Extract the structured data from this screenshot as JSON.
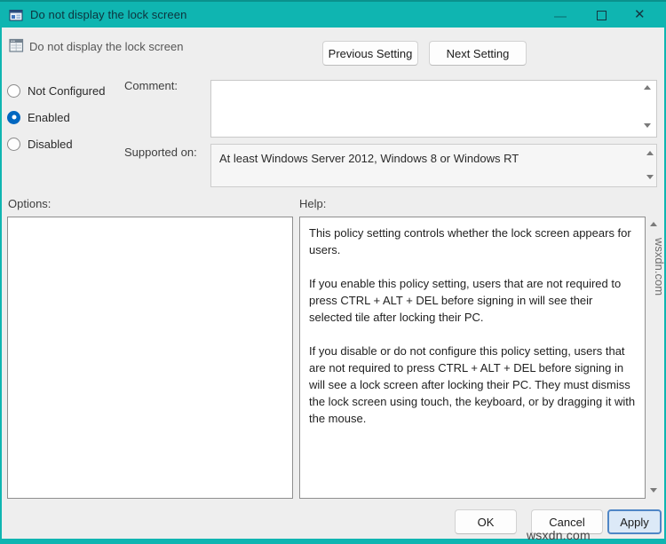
{
  "window": {
    "title": "Do not display the lock screen",
    "close_glyph": "✕"
  },
  "header": {
    "policy_title": "Do not display the lock screen",
    "previous_setting_label": "Previous Setting",
    "next_setting_label": "Next Setting"
  },
  "config": {
    "radios": [
      {
        "label": "Not Configured",
        "selected": false
      },
      {
        "label": "Enabled",
        "selected": true
      },
      {
        "label": "Disabled",
        "selected": false
      }
    ],
    "comment_label": "Comment:",
    "comment_value": "",
    "supported_on_label": "Supported on:",
    "supported_on_value": "At least Windows Server 2012, Windows 8 or Windows RT"
  },
  "panels": {
    "options_label": "Options:",
    "help_label": "Help:",
    "help_paragraphs": [
      "This policy setting controls whether the lock screen appears for users.",
      "If you enable this policy setting, users that are not required to press CTRL + ALT + DEL before signing in will see their selected tile after locking their PC.",
      "If you disable or do not configure this policy setting, users that are not required to press CTRL + ALT + DEL before signing in will see a lock screen after locking their PC. They must dismiss the lock screen using touch, the keyboard, or by dragging it with the mouse."
    ]
  },
  "footer": {
    "ok_label": "OK",
    "cancel_label": "Cancel",
    "apply_label": "Apply"
  },
  "watermark": "wsxdn.com",
  "colors": {
    "titlebar_teal": "#0fb5b1",
    "titlebar_edge": "#0a918d",
    "accent_blue": "#0067c0",
    "apply_border": "#4f86c6",
    "apply_bg": "#dce9f7",
    "dialog_bg": "#eeeeee"
  }
}
